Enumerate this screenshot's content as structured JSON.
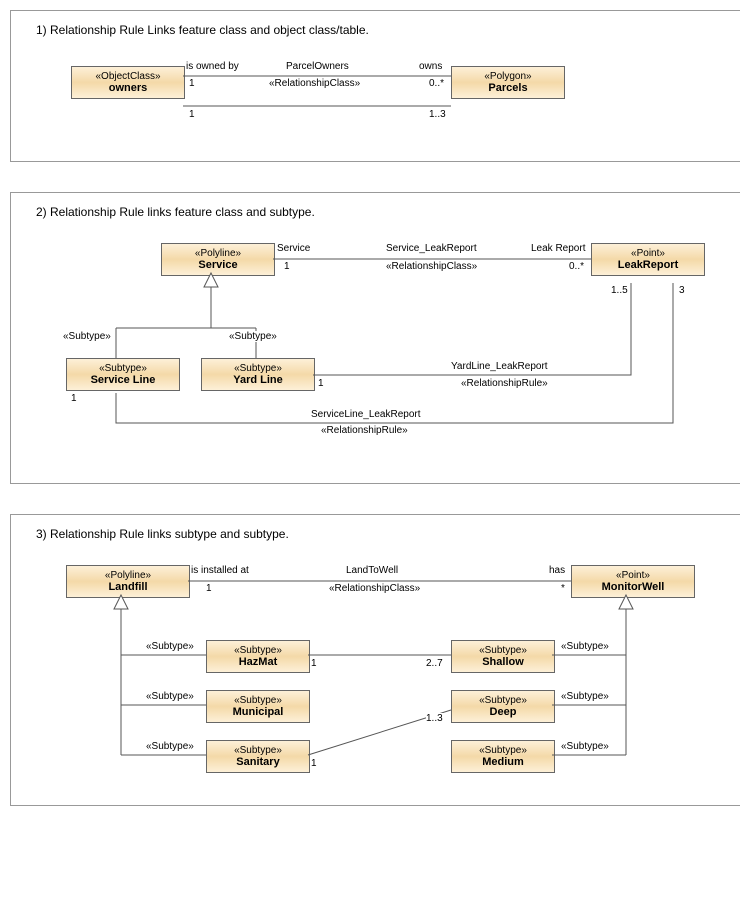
{
  "panel1": {
    "title": "1) Relationship Rule Links feature class and object class/table.",
    "owners": {
      "stereo": "«ObjectClass»",
      "name": "owners"
    },
    "parcels": {
      "stereo": "«Polygon»",
      "name": "Parcels"
    },
    "assocName": "ParcelOwners",
    "assocStereo": "«RelationshipClass»",
    "leftRole": "is owned by",
    "rightRole": "owns",
    "leftMult1": "1",
    "rightMult1": "0..*",
    "leftMult2": "1",
    "rightMult2": "1..3"
  },
  "panel2": {
    "title": "2) Relationship Rule links feature class and subtype.",
    "service": {
      "stereo": "«Polyline»",
      "name": "Service"
    },
    "leakReport": {
      "stereo": "«Point»",
      "name": "LeakReport"
    },
    "serviceLine": {
      "stereo": "«Subtype»",
      "name": "Service Line"
    },
    "yardLine": {
      "stereo": "«Subtype»",
      "name": "Yard Line"
    },
    "subtypeLabel": "«Subtype»",
    "assoc1Name": "Service_LeakReport",
    "assoc1Stereo": "«RelationshipClass»",
    "leftRole": "Service",
    "rightRole": "Leak Report",
    "leftMult1": "1",
    "rightMult1": "0..*",
    "rightMult2": "1..5",
    "rightMult3": "3",
    "assoc2Name": "YardLine_LeakReport",
    "assoc2Stereo": "«RelationshipRule»",
    "yardMult": "1",
    "assoc3Name": "ServiceLine_LeakReport",
    "assoc3Stereo": "«RelationshipRule»",
    "serviceLineMult": "1"
  },
  "panel3": {
    "title": "3) Relationship Rule links subtype and subtype.",
    "landfill": {
      "stereo": "«Polyline»",
      "name": "Landfill"
    },
    "monitorWell": {
      "stereo": "«Point»",
      "name": "MonitorWell"
    },
    "hazmat": {
      "stereo": "«Subtype»",
      "name": "HazMat"
    },
    "municipal": {
      "stereo": "«Subtype»",
      "name": "Municipal"
    },
    "sanitary": {
      "stereo": "«Subtype»",
      "name": "Sanitary"
    },
    "shallow": {
      "stereo": "«Subtype»",
      "name": "Shallow"
    },
    "deep": {
      "stereo": "«Subtype»",
      "name": "Deep"
    },
    "medium": {
      "stereo": "«Subtype»",
      "name": "Medium"
    },
    "assocName": "LandToWell",
    "assocStereo": "«RelationshipClass»",
    "leftRole": "is installed at",
    "rightRole": "has",
    "leftMult": "1",
    "rightMult": "*",
    "subtypeLabel": "«Subtype»",
    "hazmatMult": "1",
    "shallowMult": "2..7",
    "sanitaryMult": "1",
    "deepMult": "1..3"
  }
}
